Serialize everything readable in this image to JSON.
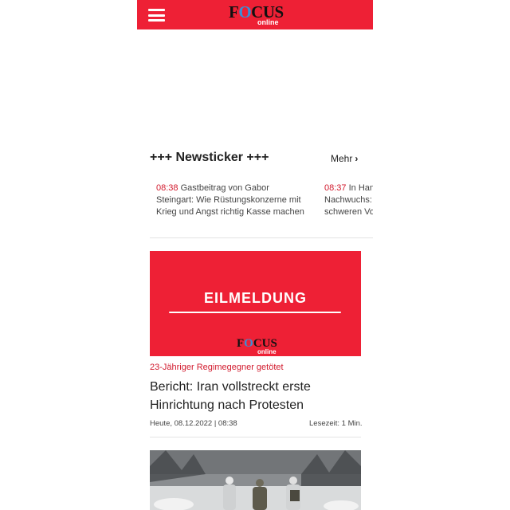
{
  "header": {
    "logo_main_pre": "F",
    "logo_main_o": "O",
    "logo_main_post": "CUS",
    "logo_sub": "online",
    "accent_color": "#ee2035"
  },
  "newsticker": {
    "title": "+++ Newsticker +++",
    "more_label": "Mehr",
    "items": [
      {
        "time": "08:38",
        "text": "Gastbeitrag von Gabor Steingart: Wie Rüstungskonzerne mit Krieg und Angst richtig Kasse machen"
      },
      {
        "time": "08:37",
        "text": "In Han\nNachwuchs:\nschweren Vo"
      }
    ]
  },
  "article": {
    "image_word": "EILMELDUNG",
    "image_logo_pre": "F",
    "image_logo_o": "O",
    "image_logo_post": "CUS",
    "image_logo_sub": "online",
    "kicker": "23-Jähriger Regimegegner getötet",
    "headline": "Bericht: Iran vollstreckt erste Hinrichtung nach Protesten",
    "date": "Heute, 08.12.2022 | 08:38",
    "read_time": "Lesezeit: 1 Min."
  },
  "icons": {
    "menu": "hamburger-icon",
    "more": "chevron-right-icon"
  }
}
